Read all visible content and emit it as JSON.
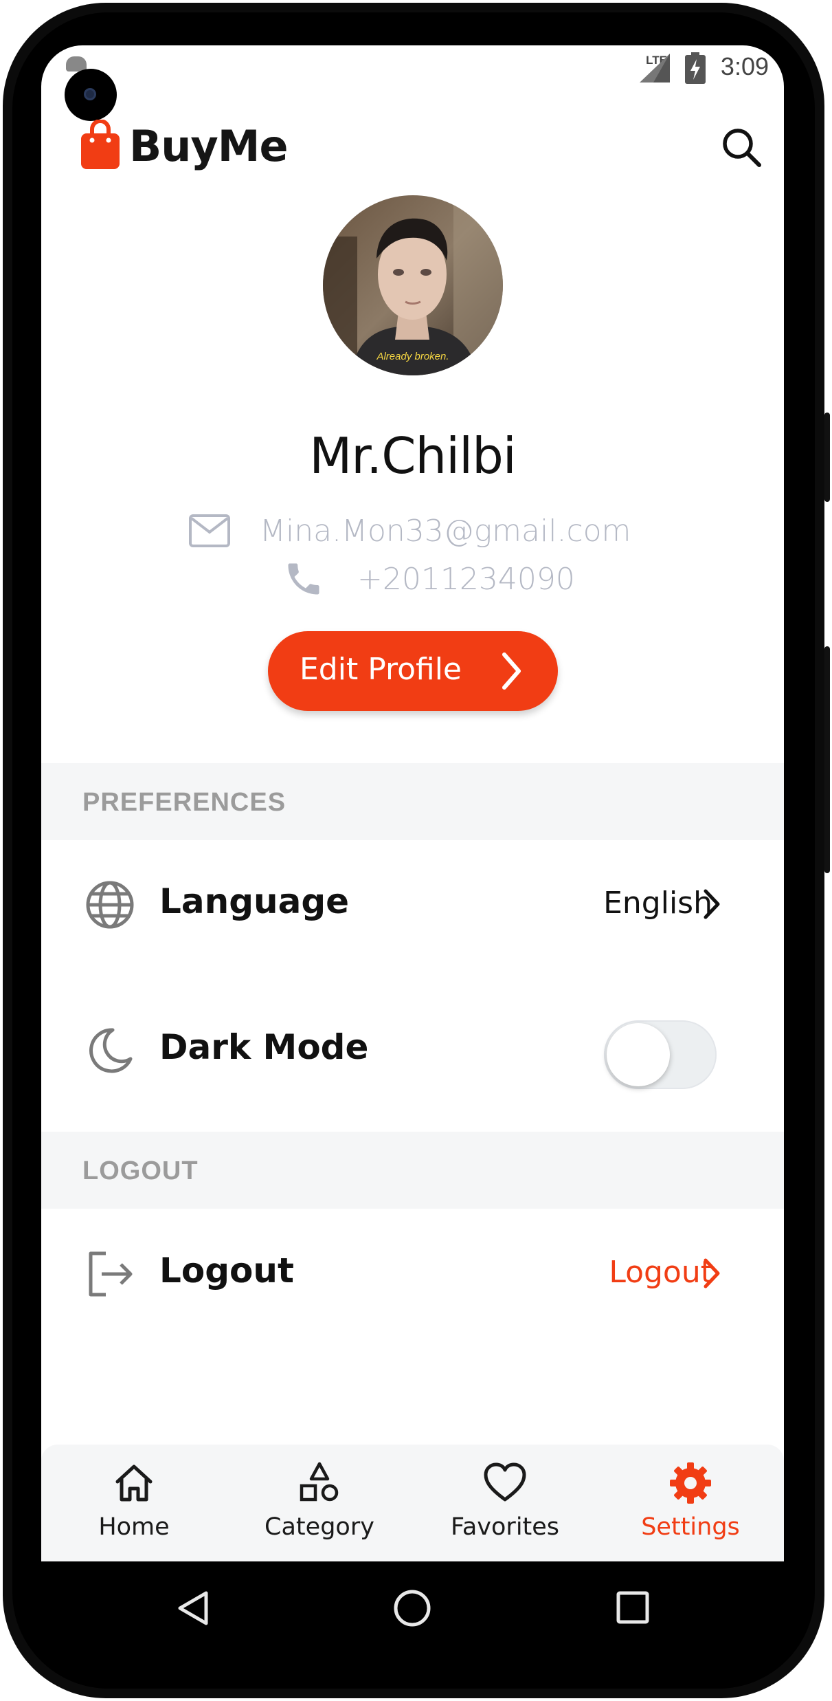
{
  "status_bar": {
    "network": "LTE",
    "time": "3:09"
  },
  "header": {
    "brand": "BuyMe"
  },
  "profile": {
    "name": "Mr.Chilbi",
    "email": "Mina.Mon33@gmail.com",
    "phone": "+2011234090",
    "avatar_caption": "Already broken.",
    "edit_label": "Edit Profile"
  },
  "preferences": {
    "section_label": "PREFERENCES",
    "language": {
      "title": "Language",
      "value": "English"
    },
    "dark_mode": {
      "title": "Dark Mode",
      "enabled": false
    }
  },
  "logout": {
    "section_label": "LOGOUT",
    "title": "Logout",
    "action": "Logout"
  },
  "bottom_nav": {
    "items": [
      {
        "label": "Home",
        "icon": "home-icon",
        "active": false
      },
      {
        "label": "Category",
        "icon": "category-icon",
        "active": false
      },
      {
        "label": "Favorites",
        "icon": "heart-icon",
        "active": false
      },
      {
        "label": "Settings",
        "icon": "gear-icon",
        "active": true
      }
    ]
  },
  "colors": {
    "accent": "#f13d14",
    "muted_text": "#b4b8c4",
    "section_bg": "#f5f6f7",
    "icon_gray": "#7a7a7a"
  }
}
